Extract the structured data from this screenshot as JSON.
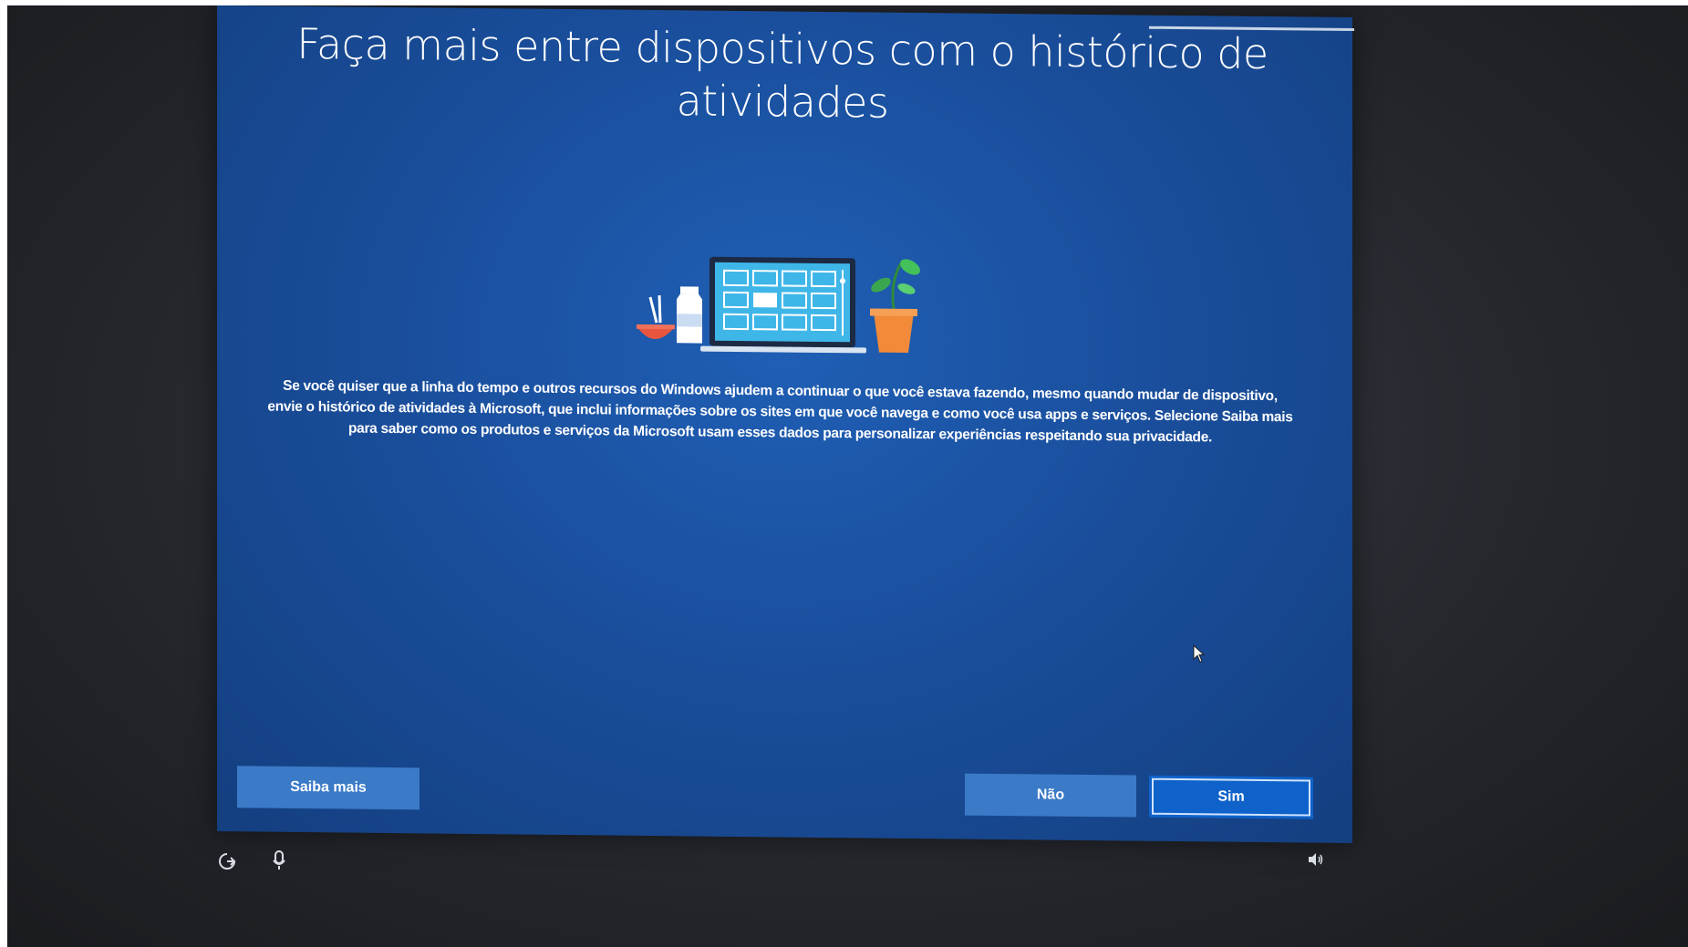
{
  "screen": {
    "title": "Faça mais entre dispositivos com o histórico de atividades",
    "body_part1": "Se você quiser que a linha do tempo e outros recursos do Windows ajudem a continuar o que você estava fazendo, mesmo quando mudar de dispositivo, envie o histórico de atividades à Microsoft, que inclui informações sobre os sites em que você navega e como você usa apps e serviços. Selecione ",
    "body_bold": "Saiba mais",
    "body_part2": " para saber como os produtos e serviços da Microsoft usam esses dados para personalizar experiências respeitando sua privacidade."
  },
  "buttons": {
    "learn_more": "Saiba mais",
    "no": "Não",
    "yes": "Sim"
  },
  "icons": {
    "accessibility": "accessibility-icon",
    "microphone": "microphone-icon",
    "volume": "volume-icon"
  },
  "colors": {
    "screen_blue": "#1a4f9d",
    "button_blue": "#3a7ac7",
    "primary_button": "#0f62c9"
  }
}
